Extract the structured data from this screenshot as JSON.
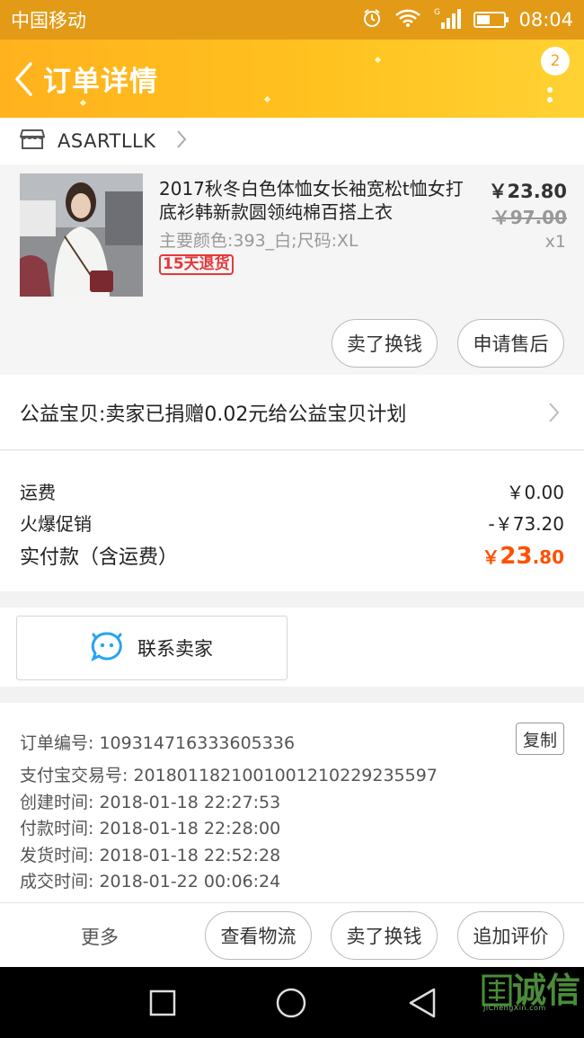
{
  "status_bar": {
    "carrier": "中国移动",
    "time": "08:04",
    "network": "G"
  },
  "nav": {
    "title": "订单详情",
    "badge_count": "2"
  },
  "shop": {
    "name": "ASARTLLK"
  },
  "product": {
    "title": "2017秋冬白色体恤女长袖宽松t恤女打底衫韩新款圆领纯棉百搭上衣",
    "sku": "主要颜色:393_白;尺码:XL",
    "return_tag": "15天退货",
    "price": "￥23.80",
    "original_price": "￥97.00",
    "quantity": "x1",
    "sell_button": "卖了换钱",
    "after_sale_button": "申请售后"
  },
  "charity": {
    "text": "公益宝贝:卖家已捐赠0.02元给公益宝贝计划"
  },
  "fees": {
    "shipping_label": "运费",
    "shipping_value": "￥0.00",
    "promo_label": "火爆促销",
    "promo_value": "-￥73.20",
    "paid_label": "实付款（含运费）",
    "paid_currency": "￥",
    "paid_integer": "23",
    "paid_decimal": ".80"
  },
  "contact": {
    "label": "联系卖家"
  },
  "order_info": {
    "order_no": "订单编号: 109314716333605336",
    "alipay_no": "支付宝交易号: 2018011821001001210229235597",
    "created": "创建时间: 2018-01-18 22:27:53",
    "paid": "付款时间: 2018-01-18 22:28:00",
    "shipped": "发货时间: 2018-01-18 22:52:28",
    "completed": "成交时间: 2018-01-22 00:06:24",
    "copy_button": "复制"
  },
  "actions": {
    "more": "更多",
    "logistics": "查看物流",
    "sell": "卖了换钱",
    "review": "追加评价"
  },
  "watermark": {
    "logo": "诚信",
    "sub": "JiChengXin.com"
  },
  "colors": {
    "accent": "#ff5000",
    "nav_yellow": "#ffc21f",
    "status_orange": "#e39a16"
  }
}
